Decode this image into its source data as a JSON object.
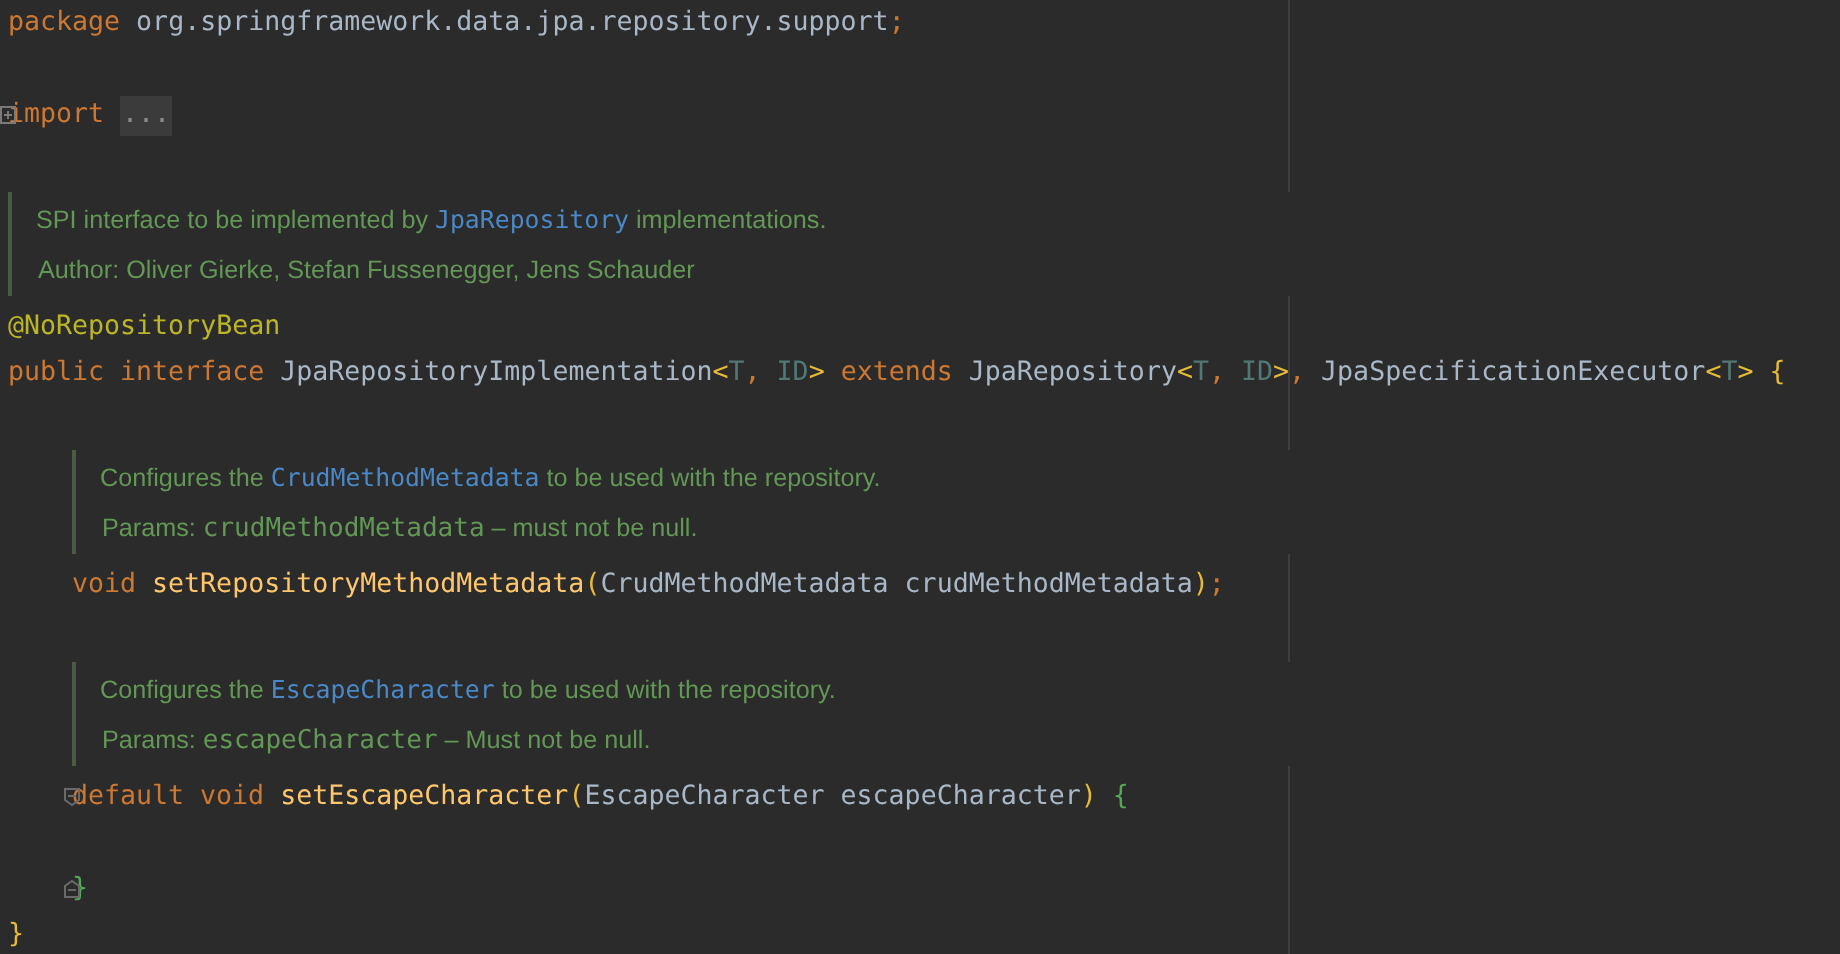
{
  "editor": {
    "lines": [
      {
        "kind": "code",
        "tokens": [
          {
            "text": "package",
            "kind": "keyword"
          },
          {
            "text": " org.springframework.data.jpa.repository.support",
            "kind": "plain"
          },
          {
            "text": ";",
            "kind": "punct"
          }
        ]
      },
      {
        "kind": "blank"
      },
      {
        "kind": "code",
        "fold": {
          "kind": "start",
          "collapsed": true
        },
        "tokens": [
          {
            "text": "import ",
            "kind": "keyword"
          },
          {
            "text": "...",
            "kind": "placeholder"
          }
        ]
      },
      {
        "kind": "blank"
      },
      {
        "kind": "doc",
        "lines": [
          {
            "parts": [
              {
                "text": "SPI interface to be implemented by ",
                "kind": "text"
              },
              {
                "text": "JpaRepository",
                "kind": "link"
              },
              {
                "text": " implementations.",
                "kind": "text"
              }
            ]
          },
          {
            "parts": [
              {
                "text": "Author: Oliver Gierke, Stefan Fussenegger, Jens Schauder",
                "kind": "text"
              }
            ]
          }
        ]
      },
      {
        "kind": "code",
        "tokens": [
          {
            "text": "@NoRepositoryBean",
            "kind": "annotation"
          }
        ]
      },
      {
        "kind": "code",
        "tokens": [
          {
            "text": "public interface",
            "kind": "keyword"
          },
          {
            "text": " JpaRepositoryImplementation",
            "kind": "plain"
          },
          {
            "text": "<",
            "kind": "bracket_yellow"
          },
          {
            "text": "T",
            "kind": "type_param"
          },
          {
            "text": ", ",
            "kind": "punct"
          },
          {
            "text": "ID",
            "kind": "type_param"
          },
          {
            "text": ">",
            "kind": "bracket_yellow"
          },
          {
            "text": " extends",
            "kind": "keyword"
          },
          {
            "text": " JpaRepository",
            "kind": "plain"
          },
          {
            "text": "<",
            "kind": "bracket_yellow"
          },
          {
            "text": "T",
            "kind": "type_param"
          },
          {
            "text": ", ",
            "kind": "punct"
          },
          {
            "text": "ID",
            "kind": "type_param"
          },
          {
            "text": ">",
            "kind": "bracket_yellow"
          },
          {
            "text": ", ",
            "kind": "punct"
          },
          {
            "text": "JpaSpecificationExecutor",
            "kind": "plain"
          },
          {
            "text": "<",
            "kind": "bracket_yellow"
          },
          {
            "text": "T",
            "kind": "type_param"
          },
          {
            "text": ">",
            "kind": "bracket_yellow"
          },
          {
            "text": " {",
            "kind": "bracket_yellow"
          }
        ],
        "children": [
          {
            "kind": "blank"
          },
          {
            "kind": "doc",
            "lines": [
              {
                "parts": [
                  {
                    "text": "Configures the ",
                    "kind": "text"
                  },
                  {
                    "text": "CrudMethodMetadata",
                    "kind": "link"
                  },
                  {
                    "text": " to be used with the repository.",
                    "kind": "text"
                  }
                ]
              },
              {
                "parts": [
                  {
                    "text": "Params: ",
                    "kind": "text"
                  },
                  {
                    "text": "crudMethodMetadata",
                    "kind": "code"
                  },
                  {
                    "text": " – must not be null.",
                    "kind": "text"
                  }
                ]
              }
            ]
          },
          {
            "kind": "code",
            "tokens": [
              {
                "text": "void",
                "kind": "keyword"
              },
              {
                "text": " setRepositoryMethodMetadata",
                "kind": "method"
              },
              {
                "text": "(",
                "kind": "bracket_yellow"
              },
              {
                "text": "CrudMethodMetadata crudMethodMetadata",
                "kind": "plain"
              },
              {
                "text": ")",
                "kind": "bracket_yellow"
              },
              {
                "text": ";",
                "kind": "punct"
              }
            ]
          },
          {
            "kind": "blank"
          },
          {
            "kind": "doc",
            "lines": [
              {
                "parts": [
                  {
                    "text": "Configures the ",
                    "kind": "text"
                  },
                  {
                    "text": "EscapeCharacter",
                    "kind": "link"
                  },
                  {
                    "text": " to be used with the repository.",
                    "kind": "text"
                  }
                ]
              },
              {
                "parts": [
                  {
                    "text": "Params: ",
                    "kind": "text"
                  },
                  {
                    "text": "escapeCharacter",
                    "kind": "code"
                  },
                  {
                    "text": " – Must not be null.",
                    "kind": "text"
                  }
                ]
              }
            ]
          },
          {
            "kind": "code",
            "fold": {
              "kind": "start",
              "collapsed": false
            },
            "tokens": [
              {
                "text": "default void",
                "kind": "keyword"
              },
              {
                "text": " setEscapeCharacter",
                "kind": "method"
              },
              {
                "text": "(",
                "kind": "bracket_yellow"
              },
              {
                "text": "EscapeCharacter escapeCharacter",
                "kind": "plain"
              },
              {
                "text": ")",
                "kind": "bracket_yellow"
              },
              {
                "text": " {",
                "kind": "bracket_green"
              }
            ]
          },
          {
            "kind": "blank"
          },
          {
            "kind": "code",
            "fold": {
              "kind": "end"
            },
            "tokens": [
              {
                "text": "}",
                "kind": "bracket_green"
              }
            ]
          }
        ]
      },
      {
        "kind": "code",
        "tokens": [
          {
            "text": "}",
            "kind": "bracket_yellow"
          }
        ]
      }
    ]
  }
}
